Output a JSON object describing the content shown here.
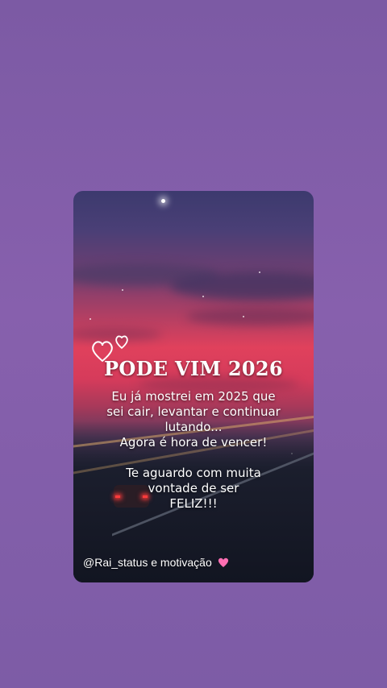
{
  "post": {
    "title": "PODE VIM 2026",
    "lines": [
      "Eu já mostrei em 2025 que",
      "sei cair, levantar e continuar",
      "lutando...",
      "Agora é hora de vencer!",
      "",
      "Te aguardo com muita",
      "vontade de ser",
      "FELIZ!!!"
    ],
    "credit": "@Rai_status e motivação",
    "credit_icon": "pink-heart-icon"
  },
  "colors": {
    "page_background": "#8760ad",
    "sky_pink": "#e0415c",
    "text": "#ffffff",
    "heart": "#ff6fb3"
  }
}
